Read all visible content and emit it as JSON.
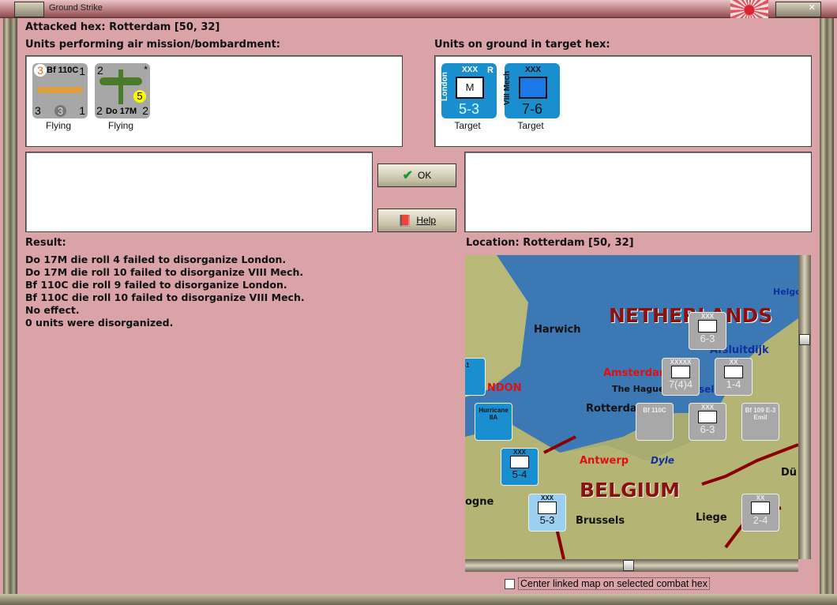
{
  "window": {
    "title": "Ground Strike"
  },
  "attacked_hex": "Attacked hex: Rotterdam  [50, 32]",
  "air_units": {
    "label": "Units performing air mission/bombardment:",
    "units": [
      {
        "name": "Bf 110C",
        "top_left": "3",
        "top_right": "1",
        "bottom_left": "3",
        "bottom_mid": "3",
        "bottom_right": "1",
        "status": "Flying"
      },
      {
        "name": "Do 17M",
        "top_left": "2",
        "top_right": "*",
        "badge": "5",
        "bottom_left": "2",
        "bottom_right": "2",
        "status": "Flying"
      }
    ]
  },
  "ground_units": {
    "label": "Units on ground in target hex:",
    "units": [
      {
        "name": "London",
        "size": "XXX",
        "flag": "R",
        "symbol": "M",
        "strength": "5-3",
        "status": "Target"
      },
      {
        "name": "VIII Mech",
        "size": "XXX",
        "flag": "",
        "symbol": "",
        "strength": "7-6",
        "status": "Target"
      }
    ]
  },
  "buttons": {
    "ok": "OK",
    "help": "Help"
  },
  "result": {
    "label": "Result:",
    "lines": [
      "Do 17M die roll 4 failed to disorganize London.",
      "Do 17M die roll 10 failed to disorganize VIII Mech.",
      "Bf 110C die roll 9 failed to disorganize London.",
      "Bf 110C die roll 10 failed to disorganize VIII Mech.",
      "No effect.",
      "0 units were disorganized."
    ]
  },
  "location": "Location:  Rotterdam  [50, 32]",
  "map": {
    "countries": [
      "NETHERLANDS",
      "BELGIUM"
    ],
    "cities": [
      "Harwich",
      "Amsterdam",
      "The Hague",
      "Rotterdam",
      "Antwerp",
      "Brussels",
      "Liege",
      "NDON",
      "ogne",
      "Helgo",
      "Dü",
      "Afsluitdijk",
      "Dyle",
      "sel"
    ],
    "counters": [
      {
        "label": "6-3",
        "size": "XXX",
        "color": "grey"
      },
      {
        "label": "7(4)4",
        "size": "XXXXX",
        "color": "grey"
      },
      {
        "label": "1-4",
        "size": "XX",
        "color": "grey"
      },
      {
        "label": "Bf 110C",
        "color": "grey"
      },
      {
        "label": "6-3",
        "size": "XXX",
        "color": "grey"
      },
      {
        "label": "Bf 109 E-3 Emil",
        "color": "grey"
      },
      {
        "label": "-1",
        "color": "blue"
      },
      {
        "label": "Hurricane IIA",
        "color": "blue"
      },
      {
        "label": "5-4",
        "size": "XXX",
        "color": "blue"
      },
      {
        "label": "5-3",
        "size": "XXX",
        "color": "lightblue"
      },
      {
        "label": "2-4",
        "size": "XX",
        "color": "grey"
      }
    ]
  },
  "center_map_checkbox": {
    "label": "Center linked map on selected combat hex",
    "checked": false
  },
  "colors": {
    "bg": "#d9a3a8",
    "counter_blue": "#1a8fd0",
    "counter_grey": "#a7a7a7",
    "country_label": "#8b0000"
  }
}
